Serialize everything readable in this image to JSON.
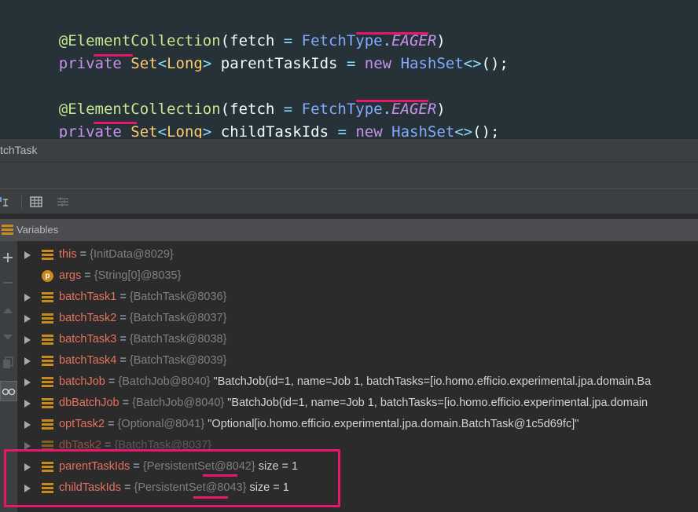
{
  "editor": {
    "line1": {
      "annotation": "@ElementCollection",
      "paren_open": "(",
      "param": "fetch",
      "eq": " = ",
      "enum_type": "FetchType",
      "dot": ".",
      "enum_const": "EAGER",
      "paren_close": ")"
    },
    "line2": {
      "modifier": "private",
      "type": "Set",
      "generic_open": "<",
      "generic_type": "Long",
      "generic_close": ">",
      "name": "parentTaskIds",
      "eq": " = ",
      "new_kw": "new",
      "impl": "HashSet",
      "diamond": "<>",
      "tail": "();"
    },
    "line3": {
      "annotation": "@ElementCollection",
      "paren_open": "(",
      "param": "fetch",
      "eq": " = ",
      "enum_type": "FetchType",
      "dot": ".",
      "enum_const": "EAGER",
      "paren_close": ")"
    },
    "line4": {
      "modifier": "private",
      "type": "Set",
      "generic_open": "<",
      "generic_type": "Long",
      "generic_close": ">",
      "name": "childTaskIds",
      "eq": " = ",
      "new_kw": "new",
      "impl": "HashSet",
      "diamond": "<>",
      "tail": "();"
    }
  },
  "debug": {
    "title": "tchTask",
    "variables_label": "Variables",
    "variables": [
      {
        "name": "this",
        "eq": " = ",
        "ref": "{InitData@8029}",
        "value": "",
        "expandable": true,
        "kind": "field"
      },
      {
        "name": "args",
        "eq": " = ",
        "ref": "{String[0]@8035}",
        "value": "",
        "expandable": false,
        "kind": "param"
      },
      {
        "name": "batchTask1",
        "eq": " = ",
        "ref": "{BatchTask@8036}",
        "value": "",
        "expandable": true,
        "kind": "field"
      },
      {
        "name": "batchTask2",
        "eq": " = ",
        "ref": "{BatchTask@8037}",
        "value": "",
        "expandable": true,
        "kind": "field"
      },
      {
        "name": "batchTask3",
        "eq": " = ",
        "ref": "{BatchTask@8038}",
        "value": "",
        "expandable": true,
        "kind": "field"
      },
      {
        "name": "batchTask4",
        "eq": " = ",
        "ref": "{BatchTask@8039}",
        "value": "",
        "expandable": true,
        "kind": "field"
      },
      {
        "name": "batchJob",
        "eq": " = ",
        "ref": "{BatchJob@8040}",
        "value": " \"BatchJob(id=1, name=Job 1, batchTasks=[io.homo.efficio.experimental.jpa.domain.Ba",
        "expandable": true,
        "kind": "field"
      },
      {
        "name": "dbBatchJob",
        "eq": " = ",
        "ref": "{BatchJob@8040}",
        "value": " \"BatchJob(id=1, name=Job 1, batchTasks=[io.homo.efficio.experimental.jpa.domain",
        "expandable": true,
        "kind": "field"
      },
      {
        "name": "optTask2",
        "eq": " = ",
        "ref": "{Optional@8041}",
        "value": " \"Optional[io.homo.efficio.experimental.jpa.domain.BatchTask@1c5d69fc]\"",
        "expandable": true,
        "kind": "field"
      },
      {
        "name": "dbTask2",
        "eq": " = ",
        "ref": "{BatchTask@8037}",
        "value": "",
        "expandable": true,
        "kind": "field"
      },
      {
        "name": "parentTaskIds",
        "eq": " = ",
        "ref": "{PersistentSet@8042}",
        "value": "  size = 1",
        "expandable": true,
        "kind": "field"
      },
      {
        "name": "childTaskIds",
        "eq": " = ",
        "ref": "{PersistentSet@8043}",
        "value": "  size = 1",
        "expandable": true,
        "kind": "field"
      }
    ]
  },
  "colors": {
    "highlight": "#e8176b",
    "editor_bg": "#263238",
    "var_name": "#e57360",
    "panel_bg": "#2b2b2b"
  },
  "icons": {
    "toolbar": [
      "restore-layout-icon",
      "table-icon",
      "settings-icon"
    ],
    "gutter": [
      "plus-icon",
      "minus-icon",
      "up-arrow-icon",
      "down-arrow-icon",
      "copy-icon",
      "glasses-icon"
    ],
    "header": "variables-icon"
  }
}
